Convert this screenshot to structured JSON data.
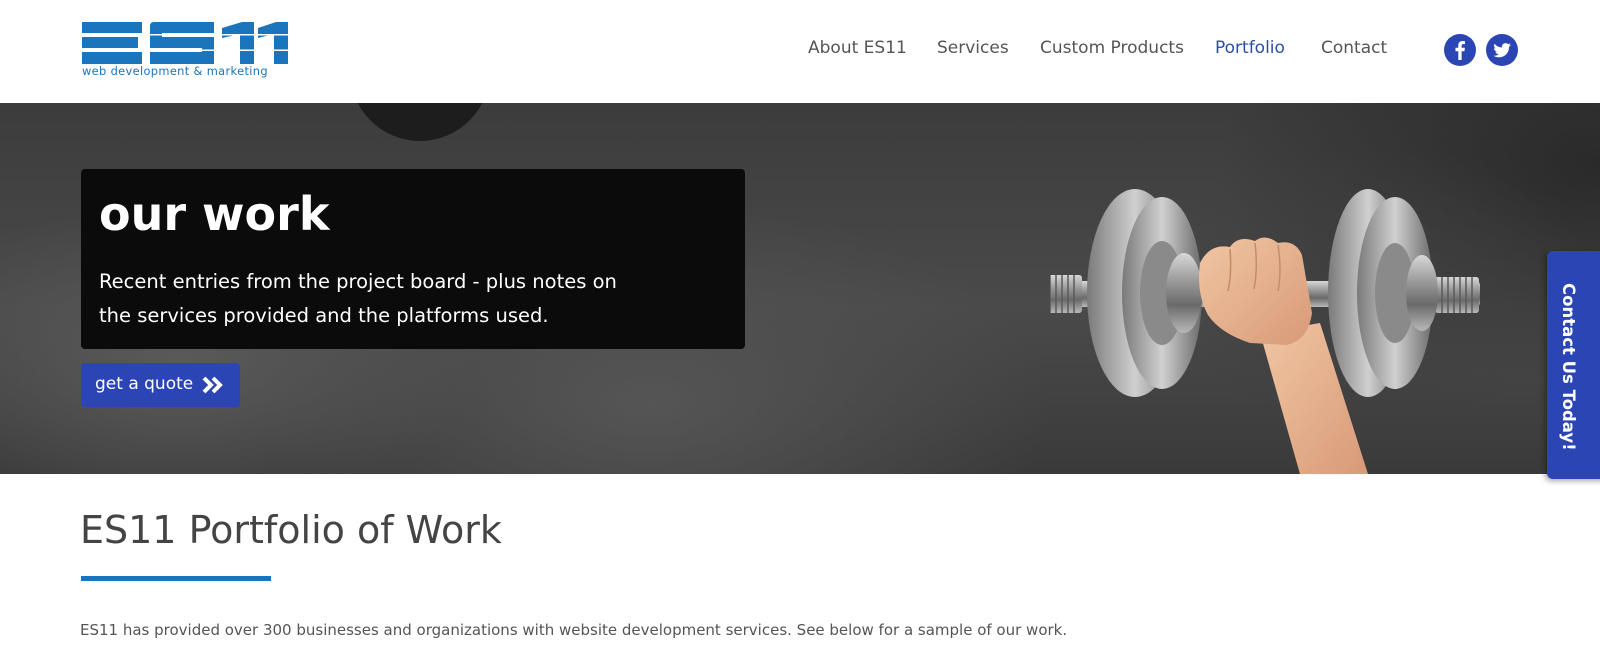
{
  "colors": {
    "brand_blue": "#1b75bc",
    "accent_blue": "#2c45b4",
    "text": "#444444",
    "hero_card": "#0b0b0b"
  },
  "header": {
    "logo": {
      "text": "ES11",
      "tagline": "web development & marketing"
    },
    "nav": [
      {
        "label": "About ES11",
        "active": false
      },
      {
        "label": "Services",
        "active": false
      },
      {
        "label": "Custom Products",
        "active": false
      },
      {
        "label": "Portfolio",
        "active": true
      },
      {
        "label": "Contact",
        "active": false
      }
    ],
    "social": [
      {
        "icon": "facebook-icon"
      },
      {
        "icon": "twitter-icon"
      }
    ]
  },
  "hero": {
    "title": "our work",
    "description": "Recent entries from the project board - plus notes on the services provided and the platforms used.",
    "button_label": "get a quote",
    "button_icon": "double-chevron-right-icon",
    "image": "hand-lifting-dumbbell"
  },
  "side_tab": {
    "label": "Contact Us Today!"
  },
  "content": {
    "title": "ES11 Portfolio of Work",
    "intro": "ES11 has provided over 300 businesses and organizations with website development services.  See below for a sample of our work."
  }
}
